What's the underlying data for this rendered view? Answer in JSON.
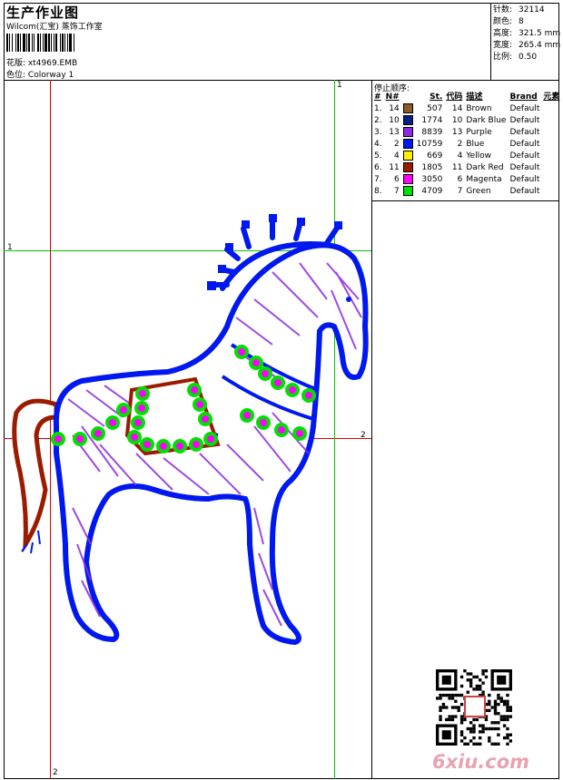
{
  "header": {
    "title": "生产作业图",
    "subtitle": "Wilcom(汇宝) 蒸饰工作室",
    "design_label": "花版:",
    "design_value": "xt4969.EMB",
    "colorway_label": "色位:",
    "colorway_value": "Colorway 1"
  },
  "info": [
    {
      "label": "针数:",
      "value": "32114"
    },
    {
      "label": "颜色:",
      "value": "8"
    },
    {
      "label": "高度:",
      "value": "321.5 mm"
    },
    {
      "label": "宽度:",
      "value": "265.4 mm"
    },
    {
      "label": "比例:",
      "value": "0.50"
    }
  ],
  "stop_sequence": {
    "title": "停止顺序:",
    "headers": [
      "#",
      "N#",
      "St.",
      "代码",
      "描述",
      "Brand",
      "元素"
    ],
    "rows": [
      {
        "idx": "1.",
        "n": "14",
        "color": "#8B5A2B",
        "st": "507",
        "code": "14",
        "desc": "Brown",
        "brand": "Default"
      },
      {
        "idx": "2.",
        "n": "10",
        "color": "#00207F",
        "st": "1774",
        "code": "10",
        "desc": "Dark Blue",
        "brand": "Default"
      },
      {
        "idx": "3.",
        "n": "13",
        "color": "#8A2BE2",
        "st": "8839",
        "code": "13",
        "desc": "Purple",
        "brand": "Default"
      },
      {
        "idx": "4.",
        "n": "2",
        "color": "#0018F0",
        "st": "10759",
        "code": "2",
        "desc": "Blue",
        "brand": "Default"
      },
      {
        "idx": "5.",
        "n": "4",
        "color": "#FFF000",
        "st": "669",
        "code": "4",
        "desc": "Yellow",
        "brand": "Default"
      },
      {
        "idx": "6.",
        "n": "11",
        "color": "#9B1B00",
        "st": "1805",
        "code": "11",
        "desc": "Dark Red",
        "brand": "Default"
      },
      {
        "idx": "7.",
        "n": "6",
        "color": "#FF00FF",
        "st": "3050",
        "code": "6",
        "desc": "Magenta",
        "brand": "Default"
      },
      {
        "idx": "8.",
        "n": "7",
        "color": "#00E000",
        "st": "4709",
        "code": "7",
        "desc": "Green",
        "brand": "Default"
      }
    ]
  },
  "guides": {
    "v1_label": "1",
    "v2_label": "2",
    "h1_label": "1",
    "h2_label": "2"
  },
  "colors": {
    "guide_green": "#00C800",
    "guide_red": "#E00000",
    "outline_blue": "#0018F0",
    "fill_purple": "#8A2BE2",
    "dark_red": "#9B1B00",
    "magenta": "#FF00FF",
    "green": "#00E000"
  },
  "watermark": {
    "text": "6xiu.com"
  }
}
